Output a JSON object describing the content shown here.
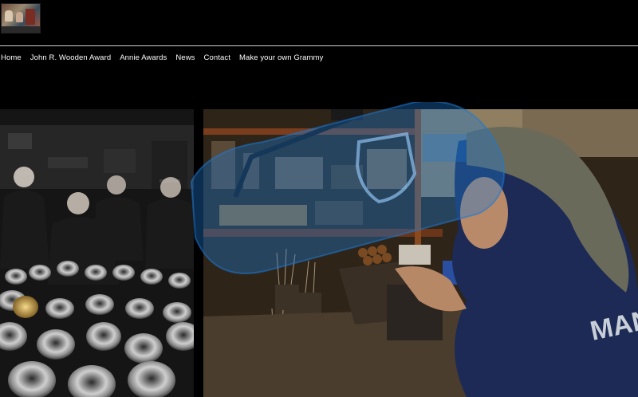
{
  "nav": {
    "items": [
      {
        "label": "Home"
      },
      {
        "label": "John R. Wooden Award"
      },
      {
        "label": "Annie Awards"
      },
      {
        "label": "News"
      },
      {
        "label": "Contact"
      },
      {
        "label": "Make your own Grammy"
      }
    ]
  },
  "photos": {
    "right_shirt_text": "MAN"
  },
  "colors": {
    "background": "#000000",
    "nav_text": "#ffffff",
    "rule": "#cfcfcf",
    "watermark": "#1e78d2"
  },
  "icons": {
    "watermark": "shield-watermark-icon"
  }
}
